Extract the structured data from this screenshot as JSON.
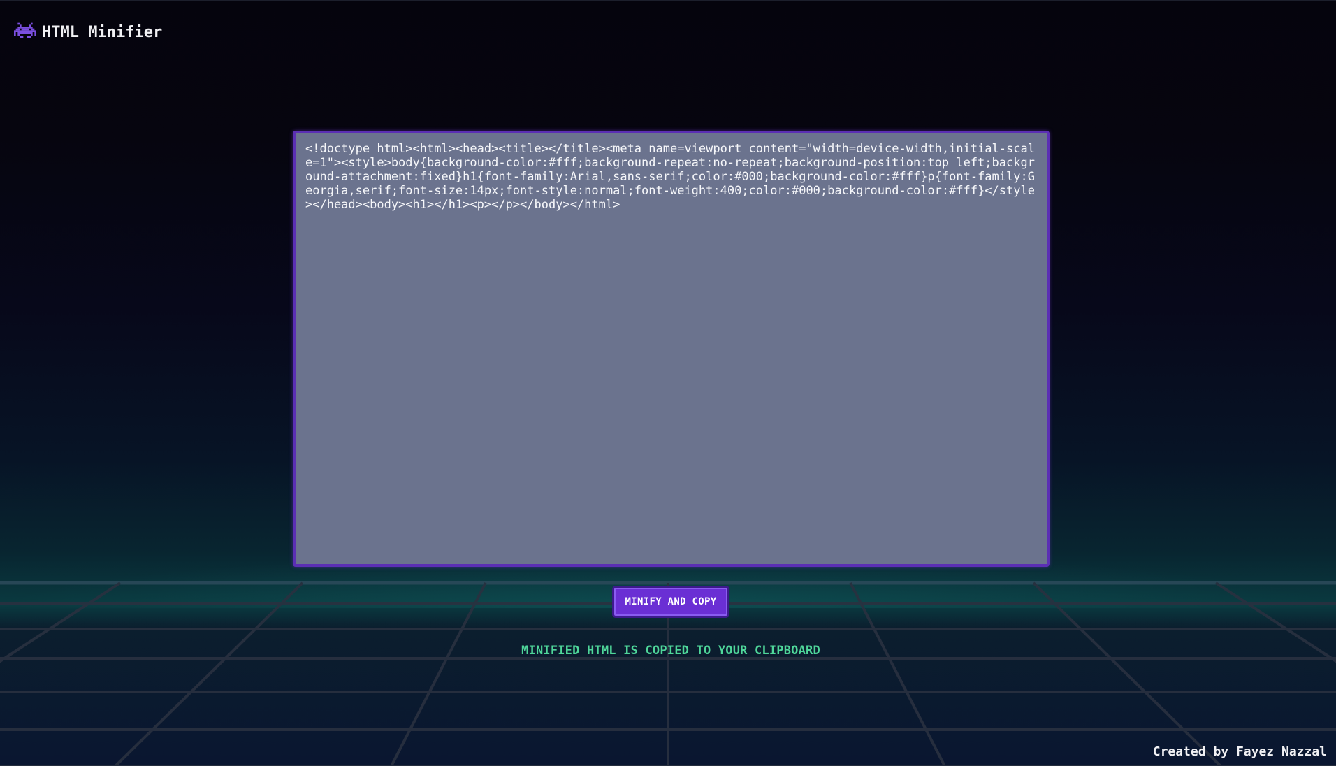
{
  "app": {
    "title": "HTML Minifier",
    "logo_icon": "space-invader-icon",
    "accent_color": "#6a2fd4"
  },
  "editor": {
    "value": "<!doctype html><html><head><title></title><meta name=viewport content=\"width=device-width,initial-scale=1\"><style>body{background-color:#fff;background-repeat:no-repeat;background-position:top left;background-attachment:fixed}h1{font-family:Arial,sans-serif;color:#000;background-color:#fff}p{font-family:Georgia,serif;font-size:14px;font-style:normal;font-weight:400;color:#000;background-color:#fff}</style></head><body><h1></h1><p></p></body></html>"
  },
  "actions": {
    "minify_label": "MINIFY AND COPY"
  },
  "status": {
    "message": "MINIFIED HTML IS COPIED TO YOUR CLIPBOARD",
    "color": "#4fd79a"
  },
  "footer": {
    "credit": "Created by Fayez Nazzal"
  }
}
